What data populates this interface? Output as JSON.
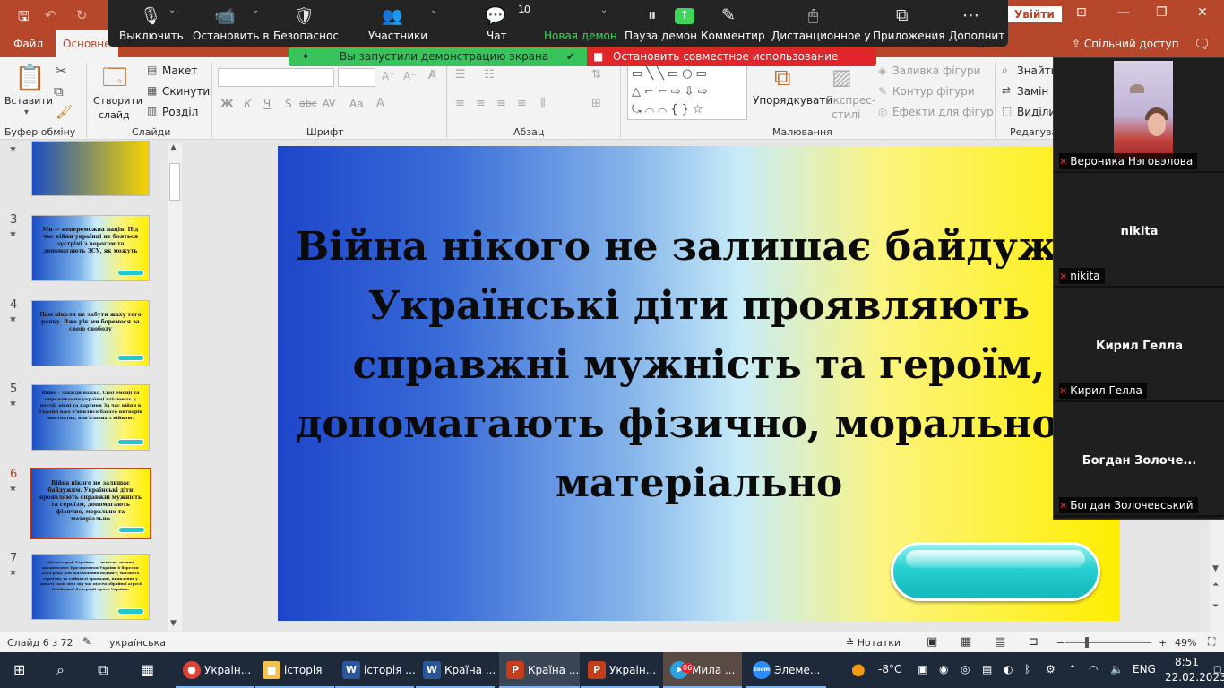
{
  "ppt": {
    "signin": "Увійти",
    "tabs": {
      "file": "Файл",
      "home": "Основне",
      "extra": "вити"
    },
    "share_label": "Спільний доступ",
    "groups": {
      "clipboard": "Буфер обміну",
      "slides": "Слайди",
      "font": "Шрифт",
      "paragraph": "Абзац",
      "drawing": "Малювання",
      "editing": "Редагува"
    },
    "buttons": {
      "paste": "Вставити",
      "new_slide_1": "Створити",
      "new_slide_2": "слайд",
      "layout": "Макет",
      "reset": "Скинути",
      "section": "Розділ",
      "arrange": "Упорядкувати",
      "express_1": "Експрес-",
      "express_2": "стилі",
      "fill": "Заливка фігури",
      "outline": "Контур фігури",
      "effects": "Ефекти для фігур",
      "find": "Знайти",
      "replace": "Замін",
      "select": "Виділи"
    },
    "font_format": {
      "bold": "Ж",
      "italic": "К",
      "underline": "Ч",
      "strike": "S",
      "strike2": "abc",
      "spacing": "AV",
      "case": "Aa"
    }
  },
  "zoom": {
    "toolbar": [
      {
        "label": "Выключить",
        "icon": "microphone-icon"
      },
      {
        "label": "Остановить в",
        "icon": "video-camera-icon"
      },
      {
        "label": "Безопаснос",
        "icon": "shield-icon"
      },
      {
        "label": "Участники",
        "icon": "participants-icon"
      },
      {
        "label": "Чат",
        "icon": "chat-icon"
      },
      {
        "label": "Новая демон",
        "icon": "share-screen-icon"
      },
      {
        "label": "Пауза демон",
        "icon": "pause-icon"
      },
      {
        "label": "Комментир",
        "icon": "pencil-icon"
      },
      {
        "label": "Дистанционное у",
        "icon": "mouse-icon"
      },
      {
        "label": "Приложения",
        "icon": "apps-icon"
      },
      {
        "label": "Дополнит",
        "icon": "more-icon"
      }
    ],
    "participants_count": "10",
    "sharing_notice": "Вы запустили демонстрацию экрана",
    "stop_sharing": "Остановить совместное использование",
    "gallery": [
      {
        "display": "",
        "name": "Вероника Нэговэлова"
      },
      {
        "display": "nikita",
        "name": "nikita"
      },
      {
        "display": "Кирил Гелла",
        "name": "Кирил Гелла"
      },
      {
        "display": "Богдан  Золоче...",
        "name": "Богдан Золочевський"
      }
    ]
  },
  "thumbnails": [
    {
      "num": "3",
      "text": "Ми — непереможна нація. Під час війни українці не бояться зустрічі з ворогом та допомагають ЗСУ, як можуть"
    },
    {
      "num": "4",
      "text": "Нам ніколи не забути жаху того ранку. Вже рік ми боремося за свою свободу"
    },
    {
      "num": "5",
      "text": "Війна - завжди важко. Свої емоції та переживання українці втілюють у поезії, пісні та картини За час війни в Україні вже з'явилися багато витворів мистецтва, пов'язаних з війною."
    },
    {
      "num": "6",
      "text": "Війна нікого не залишає байдужим. Українські діти проявляють справжні мужність та героїзм, допомагають фізично, морально та матеріально"
    },
    {
      "num": "7",
      "text": "«Місто-герой України» — почесне звання, встановлене Президентом України 6 березня 2022 року для відзначення подвигу, масового героїзму та стійкості громадян, виявлених у захисті своїх міст під час відсічі збройної агресії Російської Федерації проти України."
    }
  ],
  "slide": {
    "lines": [
      "Війна нікого не залишає байдужим.",
      "Українські діти проявляють",
      "справжні мужність та героїм,",
      "допомагають фізично, морально та",
      "матеріально"
    ]
  },
  "status": {
    "slide_counter": "Слайд 6 з 72",
    "language": "українська",
    "notes": "Нотатки",
    "zoom_percent": "49%"
  },
  "taskbar": {
    "apps": [
      {
        "label": "Украін...",
        "icon": "chrome-icon",
        "color": "#db4437"
      },
      {
        "label": "історія",
        "icon": "folder-icon",
        "color": "#f2c14e"
      },
      {
        "label": "історія ...",
        "icon": "word-icon",
        "color": "#2b579a"
      },
      {
        "label": "Країна ...",
        "icon": "word-icon",
        "color": "#2b579a"
      },
      {
        "label": "Країна ...",
        "icon": "powerpoint-icon",
        "color": "#c43e1c"
      },
      {
        "label": "Украін...",
        "icon": "powerpoint-icon",
        "color": "#c43e1c"
      },
      {
        "label": "Мила ...",
        "icon": "telegram-icon",
        "color": "#2aa3df"
      },
      {
        "label": "Элеме...",
        "icon": "zoom-icon",
        "color": "#2d8cff"
      }
    ],
    "weather": "-8°C",
    "language": "ENG",
    "time": "8:51",
    "date": "22.02.2023",
    "telegram_badge": "06"
  }
}
